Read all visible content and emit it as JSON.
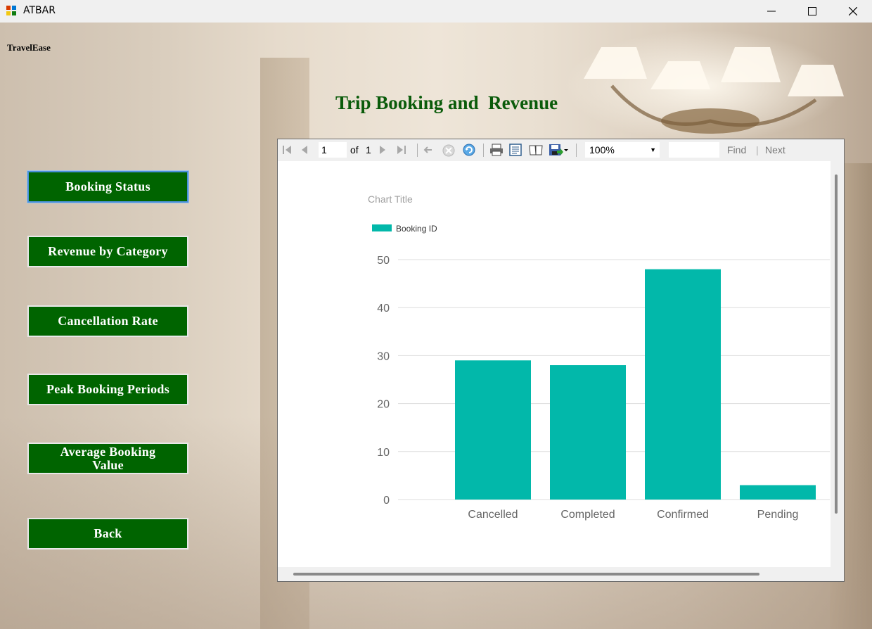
{
  "window": {
    "title": "ATBAR"
  },
  "brand": "TravelEase",
  "heading": "Trip Booking and  Revenue",
  "nav": {
    "booking_status": "Booking Status",
    "revenue_by_category": "Revenue by Category",
    "cancellation_rate": "Cancellation Rate",
    "peak_booking_periods": "Peak Booking Periods",
    "average_booking_value": "Average Booking Value",
    "back": "Back"
  },
  "viewer_toolbar": {
    "current_page": "1",
    "of_label": "of",
    "total_pages": "1",
    "zoom": "100%",
    "find_label": "Find",
    "next_label": "Next"
  },
  "chart_data": {
    "type": "bar",
    "title": "Chart Title",
    "legend": [
      "Booking ID"
    ],
    "legend_position": "top-left",
    "categories": [
      "Cancelled",
      "Completed",
      "Confirmed",
      "Pending"
    ],
    "series": [
      {
        "name": "Booking ID",
        "values": [
          29,
          28,
          48,
          3
        ]
      }
    ],
    "ylim": [
      0,
      50
    ],
    "yticks": [
      0,
      10,
      20,
      30,
      40,
      50
    ],
    "grid": true,
    "color": "#02b8aa"
  }
}
